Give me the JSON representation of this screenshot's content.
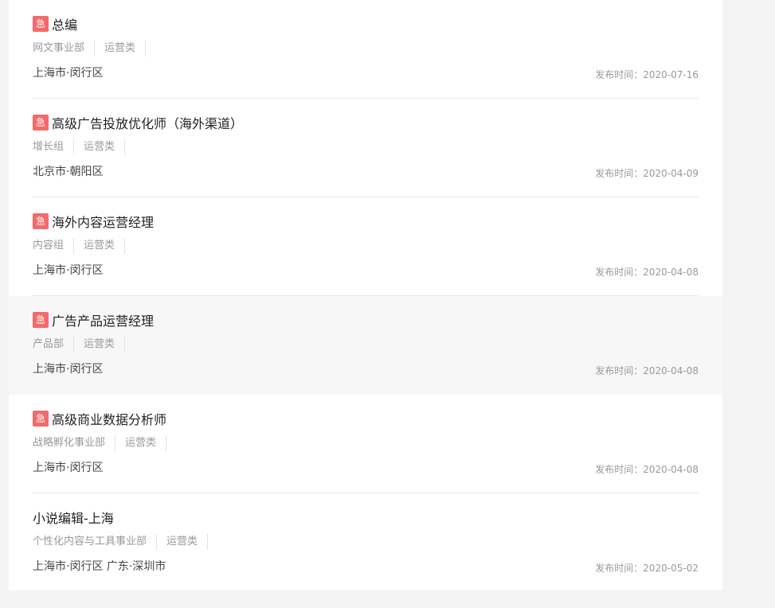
{
  "colors": {
    "urgent_badge": "#f46a6a",
    "hover_bg": "#f7f7f7",
    "page_bg": "#f4f4f5"
  },
  "date_prefix": "发布时间：",
  "jobs": [
    {
      "urgent_label": "急",
      "title": "总编",
      "department": "网文事业部",
      "category": "运营类",
      "location": "上海市·闵行区",
      "date": "发布时间：2020-07-16"
    },
    {
      "urgent_label": "急",
      "title": "高级广告投放优化师（海外渠道）",
      "department": "增长组",
      "category": "运营类",
      "location": "北京市·朝阳区",
      "date": "发布时间：2020-04-09"
    },
    {
      "urgent_label": "急",
      "title": "海外内容运营经理",
      "department": "内容组",
      "category": "运营类",
      "location": "上海市·闵行区",
      "date": "发布时间：2020-04-08"
    },
    {
      "urgent_label": "急",
      "title": "广告产品运营经理",
      "department": "产品部",
      "category": "运营类",
      "location": "上海市·闵行区",
      "date": "发布时间：2020-04-08"
    },
    {
      "urgent_label": "急",
      "title": "高级商业数据分析师",
      "department": "战略孵化事业部",
      "category": "运营类",
      "location": "上海市·闵行区",
      "date": "发布时间：2020-04-08"
    },
    {
      "urgent_label": "",
      "title": "小说编辑-上海",
      "department": "个性化内容与工具事业部",
      "category": "运营类",
      "location": "上海市·闵行区  广东·深圳市",
      "date": "发布时间：2020-05-02"
    }
  ]
}
